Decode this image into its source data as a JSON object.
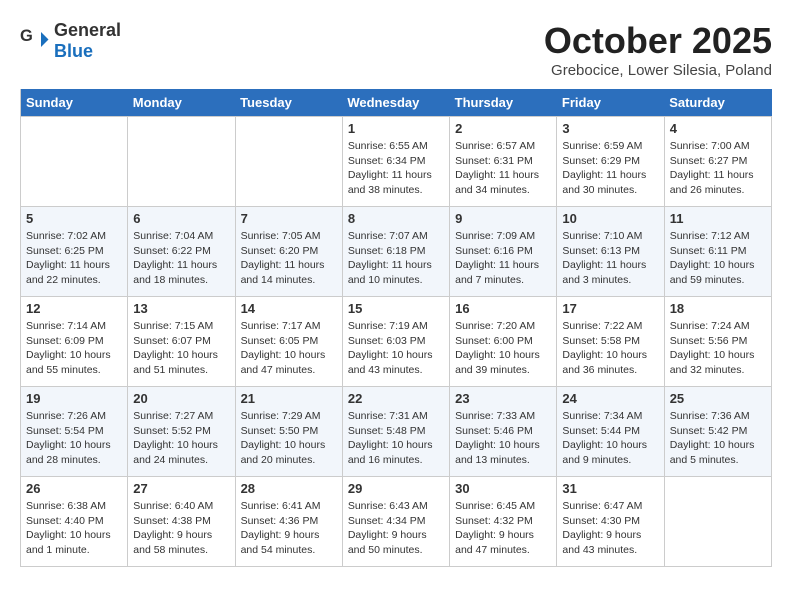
{
  "header": {
    "logo_general": "General",
    "logo_blue": "Blue",
    "month": "October 2025",
    "location": "Grebocice, Lower Silesia, Poland"
  },
  "days_of_week": [
    "Sunday",
    "Monday",
    "Tuesday",
    "Wednesday",
    "Thursday",
    "Friday",
    "Saturday"
  ],
  "weeks": [
    [
      {
        "day": "",
        "info": ""
      },
      {
        "day": "",
        "info": ""
      },
      {
        "day": "",
        "info": ""
      },
      {
        "day": "1",
        "info": "Sunrise: 6:55 AM\nSunset: 6:34 PM\nDaylight: 11 hours\nand 38 minutes."
      },
      {
        "day": "2",
        "info": "Sunrise: 6:57 AM\nSunset: 6:31 PM\nDaylight: 11 hours\nand 34 minutes."
      },
      {
        "day": "3",
        "info": "Sunrise: 6:59 AM\nSunset: 6:29 PM\nDaylight: 11 hours\nand 30 minutes."
      },
      {
        "day": "4",
        "info": "Sunrise: 7:00 AM\nSunset: 6:27 PM\nDaylight: 11 hours\nand 26 minutes."
      }
    ],
    [
      {
        "day": "5",
        "info": "Sunrise: 7:02 AM\nSunset: 6:25 PM\nDaylight: 11 hours\nand 22 minutes."
      },
      {
        "day": "6",
        "info": "Sunrise: 7:04 AM\nSunset: 6:22 PM\nDaylight: 11 hours\nand 18 minutes."
      },
      {
        "day": "7",
        "info": "Sunrise: 7:05 AM\nSunset: 6:20 PM\nDaylight: 11 hours\nand 14 minutes."
      },
      {
        "day": "8",
        "info": "Sunrise: 7:07 AM\nSunset: 6:18 PM\nDaylight: 11 hours\nand 10 minutes."
      },
      {
        "day": "9",
        "info": "Sunrise: 7:09 AM\nSunset: 6:16 PM\nDaylight: 11 hours\nand 7 minutes."
      },
      {
        "day": "10",
        "info": "Sunrise: 7:10 AM\nSunset: 6:13 PM\nDaylight: 11 hours\nand 3 minutes."
      },
      {
        "day": "11",
        "info": "Sunrise: 7:12 AM\nSunset: 6:11 PM\nDaylight: 10 hours\nand 59 minutes."
      }
    ],
    [
      {
        "day": "12",
        "info": "Sunrise: 7:14 AM\nSunset: 6:09 PM\nDaylight: 10 hours\nand 55 minutes."
      },
      {
        "day": "13",
        "info": "Sunrise: 7:15 AM\nSunset: 6:07 PM\nDaylight: 10 hours\nand 51 minutes."
      },
      {
        "day": "14",
        "info": "Sunrise: 7:17 AM\nSunset: 6:05 PM\nDaylight: 10 hours\nand 47 minutes."
      },
      {
        "day": "15",
        "info": "Sunrise: 7:19 AM\nSunset: 6:03 PM\nDaylight: 10 hours\nand 43 minutes."
      },
      {
        "day": "16",
        "info": "Sunrise: 7:20 AM\nSunset: 6:00 PM\nDaylight: 10 hours\nand 39 minutes."
      },
      {
        "day": "17",
        "info": "Sunrise: 7:22 AM\nSunset: 5:58 PM\nDaylight: 10 hours\nand 36 minutes."
      },
      {
        "day": "18",
        "info": "Sunrise: 7:24 AM\nSunset: 5:56 PM\nDaylight: 10 hours\nand 32 minutes."
      }
    ],
    [
      {
        "day": "19",
        "info": "Sunrise: 7:26 AM\nSunset: 5:54 PM\nDaylight: 10 hours\nand 28 minutes."
      },
      {
        "day": "20",
        "info": "Sunrise: 7:27 AM\nSunset: 5:52 PM\nDaylight: 10 hours\nand 24 minutes."
      },
      {
        "day": "21",
        "info": "Sunrise: 7:29 AM\nSunset: 5:50 PM\nDaylight: 10 hours\nand 20 minutes."
      },
      {
        "day": "22",
        "info": "Sunrise: 7:31 AM\nSunset: 5:48 PM\nDaylight: 10 hours\nand 16 minutes."
      },
      {
        "day": "23",
        "info": "Sunrise: 7:33 AM\nSunset: 5:46 PM\nDaylight: 10 hours\nand 13 minutes."
      },
      {
        "day": "24",
        "info": "Sunrise: 7:34 AM\nSunset: 5:44 PM\nDaylight: 10 hours\nand 9 minutes."
      },
      {
        "day": "25",
        "info": "Sunrise: 7:36 AM\nSunset: 5:42 PM\nDaylight: 10 hours\nand 5 minutes."
      }
    ],
    [
      {
        "day": "26",
        "info": "Sunrise: 6:38 AM\nSunset: 4:40 PM\nDaylight: 10 hours\nand 1 minute."
      },
      {
        "day": "27",
        "info": "Sunrise: 6:40 AM\nSunset: 4:38 PM\nDaylight: 9 hours\nand 58 minutes."
      },
      {
        "day": "28",
        "info": "Sunrise: 6:41 AM\nSunset: 4:36 PM\nDaylight: 9 hours\nand 54 minutes."
      },
      {
        "day": "29",
        "info": "Sunrise: 6:43 AM\nSunset: 4:34 PM\nDaylight: 9 hours\nand 50 minutes."
      },
      {
        "day": "30",
        "info": "Sunrise: 6:45 AM\nSunset: 4:32 PM\nDaylight: 9 hours\nand 47 minutes."
      },
      {
        "day": "31",
        "info": "Sunrise: 6:47 AM\nSunset: 4:30 PM\nDaylight: 9 hours\nand 43 minutes."
      },
      {
        "day": "",
        "info": ""
      }
    ]
  ]
}
